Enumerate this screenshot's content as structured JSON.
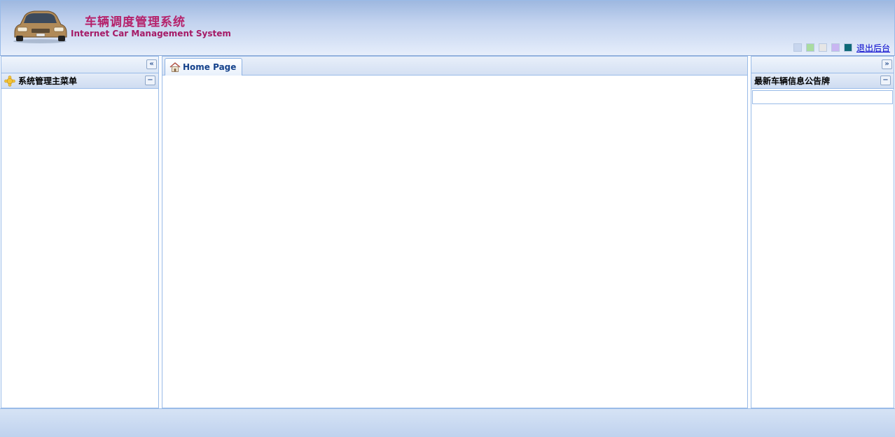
{
  "header": {
    "title_cn": "车辆调度管理系统",
    "title_en": "Internet Car Management System",
    "logout_label": "退出后台",
    "theme_colors": [
      "#c8d6ee",
      "#a9dca0",
      "#e6e6e6",
      "#c9b6f2",
      "#0f6a78"
    ]
  },
  "left_panel": {
    "menu_title": "系统管理主菜单",
    "collapse_icon": "double-chevron-left-icon",
    "head_icon": "puzzle-icon"
  },
  "center_panel": {
    "tab_label": "Home Page",
    "tab_icon": "home-icon"
  },
  "right_panel": {
    "board_title": "最新车辆信息公告牌",
    "collapse_icon": "double-chevron-right-icon"
  }
}
